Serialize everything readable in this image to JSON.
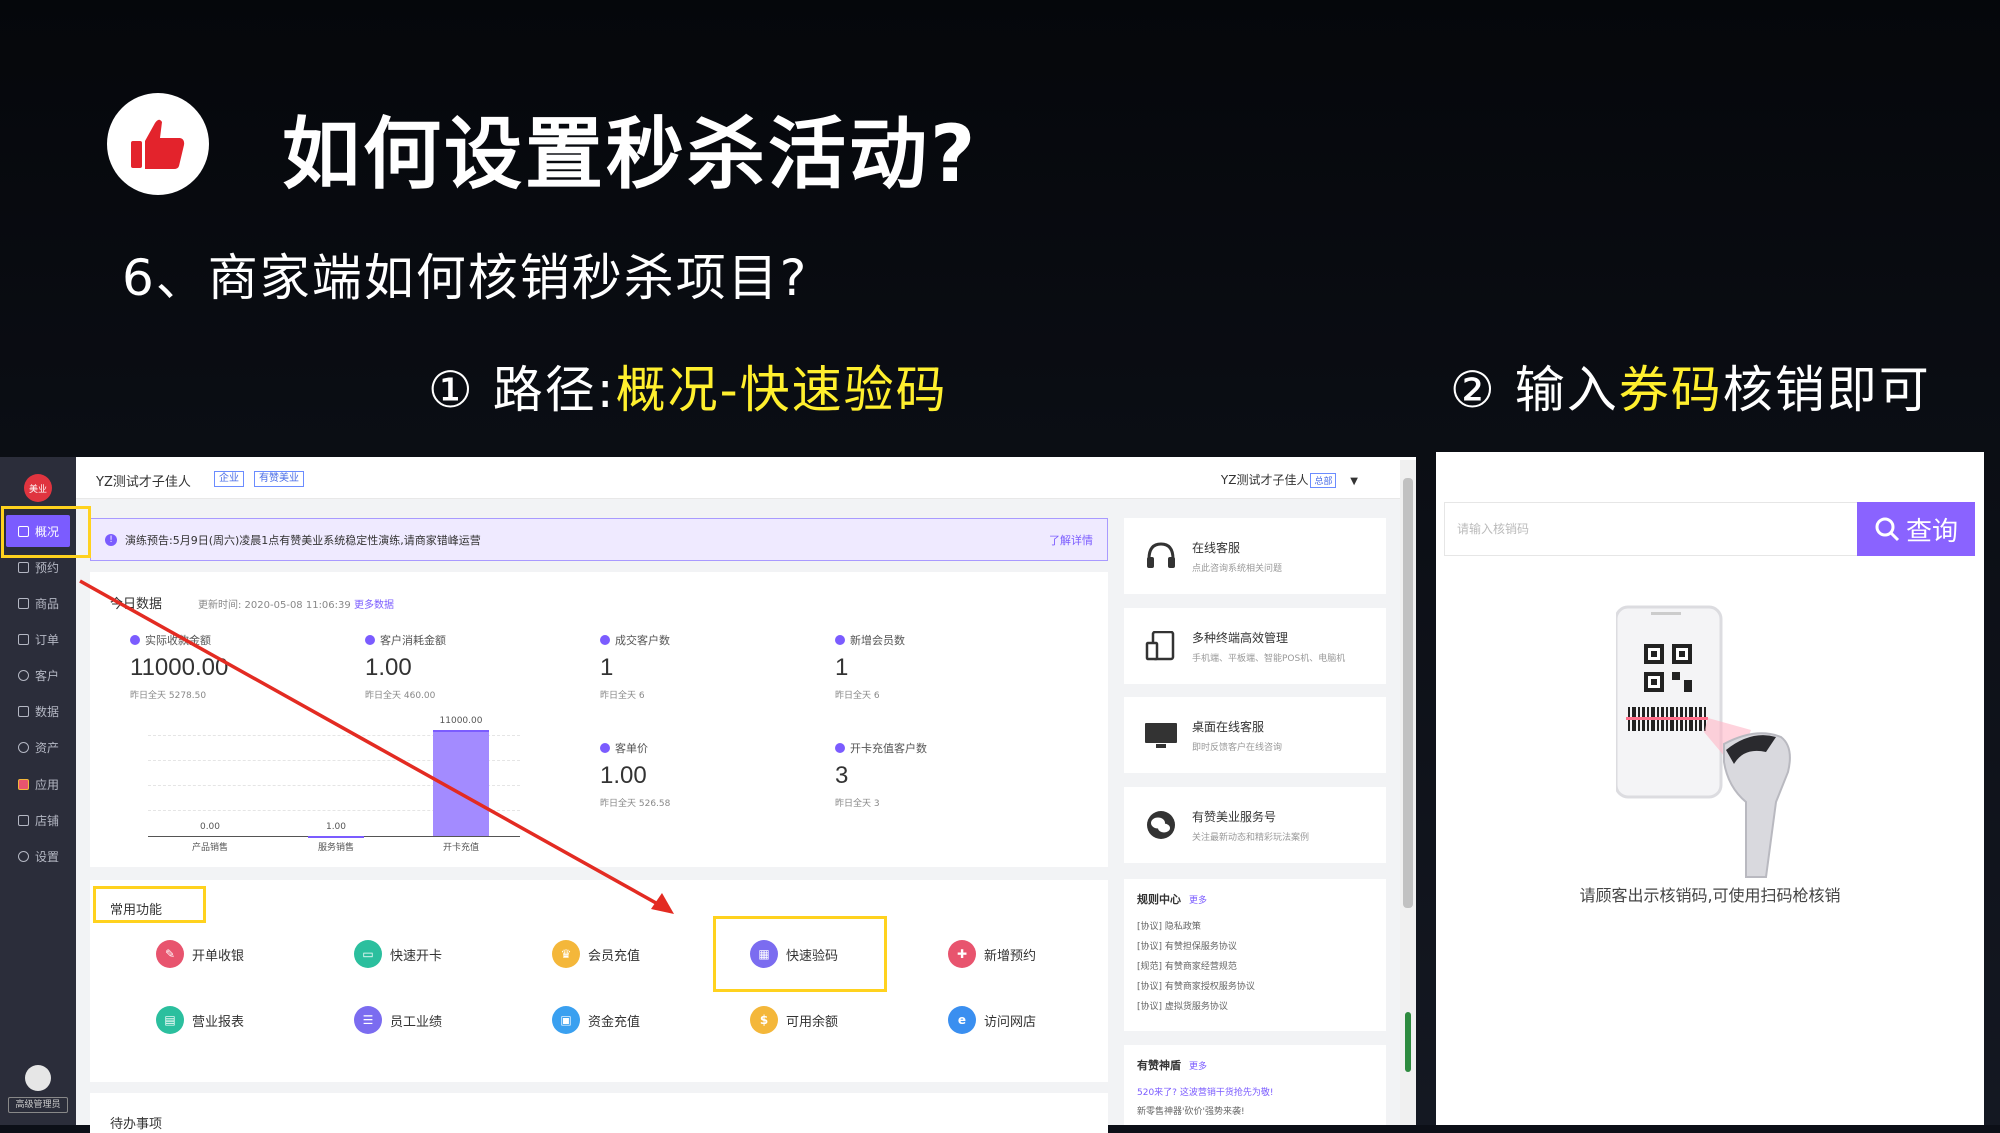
{
  "slide": {
    "title": "如何设置秒杀活动?",
    "subtitle": "6、商家端如何核销秒杀项目?",
    "step1_prefix": "① 路径:",
    "step1_highlight": "概况-快速验码",
    "step2_prefix": "② 输入",
    "step2_highlight": "券码",
    "step2_suffix": "核销即可"
  },
  "sidebar": {
    "logo": "美业",
    "items": [
      {
        "label": "概况"
      },
      {
        "label": "预约"
      },
      {
        "label": "商品"
      },
      {
        "label": "订单"
      },
      {
        "label": "客户"
      },
      {
        "label": "数据"
      },
      {
        "label": "资产"
      },
      {
        "label": "应用"
      },
      {
        "label": "店铺"
      },
      {
        "label": "设置"
      }
    ],
    "role": "高级管理员"
  },
  "topbar": {
    "shop_name": "YZ测试才子佳人",
    "tag1": "企业",
    "tag2": "有赞美业",
    "user_name": "YZ测试才子佳人",
    "user_tag": "总部",
    "dropdown": "▼"
  },
  "notice": {
    "icon": "!",
    "text": "演练预告:5月9日(周六)凌晨1点有赞美业系统稳定性演练,请商家错峰运营",
    "link": "了解详情"
  },
  "today": {
    "title": "今日数据",
    "update": "更新时间: 2020-05-08 11:06:39",
    "more": "更多数据",
    "stats": [
      {
        "label": "实际收款金额",
        "value": "11000.00",
        "yesterday": "昨日全天  5278.50"
      },
      {
        "label": "客户消耗金额",
        "value": "1.00",
        "yesterday": "昨日全天  460.00"
      },
      {
        "label": "成交客户数",
        "value": "1",
        "yesterday": "昨日全天  6"
      },
      {
        "label": "新增会员数",
        "value": "1",
        "yesterday": "昨日全天  6"
      },
      {
        "label": "客单价",
        "value": "1.00",
        "yesterday": "昨日全天  526.58"
      },
      {
        "label": "开卡充值客户数",
        "value": "3",
        "yesterday": "昨日全天  3"
      }
    ]
  },
  "chart_data": {
    "type": "bar",
    "categories": [
      "产品销售",
      "服务销售",
      "开卡充值"
    ],
    "values": [
      0.0,
      1.0,
      11000.0
    ],
    "value_labels": [
      "0.00",
      "1.00",
      "11000.00"
    ],
    "xlabel": "",
    "ylabel": "",
    "ylim": [
      0,
      11000
    ],
    "grid": true
  },
  "functions": {
    "title": "常用功能",
    "items": [
      {
        "label": "开单收银",
        "color": "#e8546e",
        "icon": "receipt-icon"
      },
      {
        "label": "快速开卡",
        "color": "#2bbf9e",
        "icon": "card-icon"
      },
      {
        "label": "会员充值",
        "color": "#f4b73a",
        "icon": "member-icon"
      },
      {
        "label": "快速验码",
        "color": "#7b6cf0",
        "icon": "qrcode-icon"
      },
      {
        "label": "新增预约",
        "color": "#e8546e",
        "icon": "calendar-icon"
      },
      {
        "label": "营业报表",
        "color": "#2bbf9e",
        "icon": "report-icon"
      },
      {
        "label": "员工业绩",
        "color": "#7b6cf0",
        "icon": "staff-icon"
      },
      {
        "label": "资金充值",
        "color": "#3aa0f0",
        "icon": "wallet-icon"
      },
      {
        "label": "可用余额",
        "color": "#f4b73a",
        "icon": "balance-icon"
      },
      {
        "label": "访问网店",
        "color": "#3a8ff0",
        "icon": "browser-icon"
      }
    ]
  },
  "todo": {
    "title": "待办事项"
  },
  "services": [
    {
      "title": "在线客服",
      "desc": "点此咨询系统相关问题"
    },
    {
      "title": "多种终端高效管理",
      "desc": "手机端、平板端、智能POS机、电脑机"
    },
    {
      "title": "桌面在线客服",
      "desc": "即时反馈客户在线咨询"
    },
    {
      "title": "有赞美业服务号",
      "desc": "关注最新动态和精彩玩法案例"
    }
  ],
  "rules": {
    "title": "规则中心",
    "more": "更多",
    "items": [
      "[协议] 隐私政策",
      "[协议] 有赞担保服务协议",
      "[规范] 有赞商家经营规范",
      "[协议] 有赞商家授权服务协议",
      "[协议] 虚拟货服务协议"
    ]
  },
  "news": {
    "title": "有赞神盾",
    "more": "更多",
    "items": [
      "520来了? 这波营销干货抢先为敬!",
      "新零售神器'砍价'强势来袭!"
    ]
  },
  "verify": {
    "placeholder": "请输入核销码",
    "button": "查询",
    "tip": "请顾客出示核销码,可使用扫码枪核销"
  }
}
